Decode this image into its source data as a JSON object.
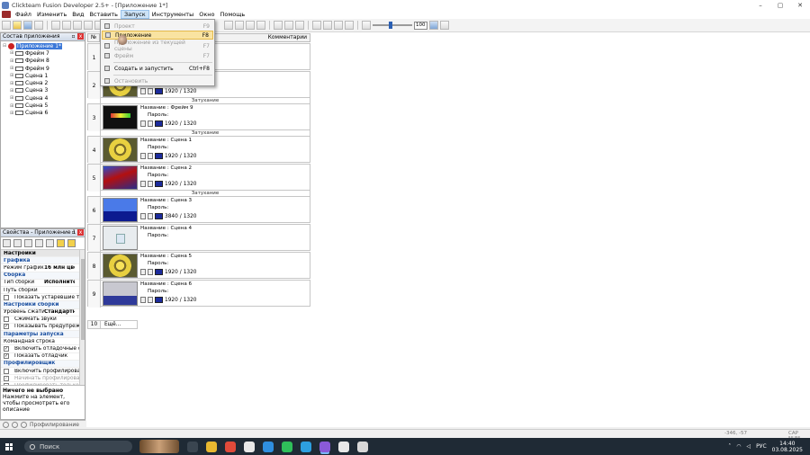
{
  "window": {
    "title": "Clickteam Fusion Developer 2.5+ - [Приложение 1*]"
  },
  "menubar": {
    "items": [
      "Файл",
      "Изменить",
      "Вид",
      "Вставить",
      "Запуск",
      "Инструменты",
      "Окно",
      "Помощь"
    ],
    "active_index": 4
  },
  "toolbar": {
    "zoom_value": "100",
    "zoom_level": 0.45
  },
  "run_menu": {
    "items": [
      {
        "label": "Проект",
        "shortcut": "F9",
        "enabled": false,
        "icon": "project-icon"
      },
      {
        "label": "Приложение",
        "shortcut": "F8",
        "enabled": true,
        "icon": "application-icon"
      },
      {
        "label": "Приложение из текущей сцены",
        "shortcut": "F7",
        "enabled": false,
        "icon": "app-from-scene-icon"
      },
      {
        "label": "Фрейм",
        "shortcut": "F7",
        "enabled": false,
        "icon": "frame-icon"
      },
      {
        "label": "Создать и запустить",
        "shortcut": "Ctrl+F8",
        "enabled": true,
        "icon": "build-run-icon"
      },
      {
        "label": "Остановить",
        "shortcut": "",
        "enabled": false,
        "icon": "stop-icon"
      }
    ]
  },
  "workspace": {
    "header": "Состав приложения",
    "root": "Приложение 1*",
    "items": [
      "Фрейм 7",
      "Фрейм 8",
      "Фрейм 9",
      "Сцена 1",
      "Сцена 2",
      "Сцена 3",
      "Сцена 4",
      "Сцена 5",
      "Сцена 6"
    ]
  },
  "properties": {
    "header": "Свойства - Приложение 1",
    "rows": [
      {
        "kind": "header",
        "key": "Настройки"
      },
      {
        "kind": "section",
        "key": "Графика"
      },
      {
        "kind": "kv",
        "key": "Режим графики",
        "value": "16 млн цвет"
      },
      {
        "kind": "section",
        "key": "Сборка"
      },
      {
        "kind": "kv",
        "key": "Тип сборки",
        "value": "Исполнительн"
      },
      {
        "kind": "kv",
        "key": "Путь сборки",
        "value": ""
      },
      {
        "kind": "check",
        "key": "Показать устаревшие типы",
        "checked": false
      },
      {
        "kind": "section",
        "key": "Настройки сборки"
      },
      {
        "kind": "kv",
        "key": "Уровень сжатия",
        "value": "Стандартный"
      },
      {
        "kind": "check",
        "key": "Сжимать звуки",
        "checked": false
      },
      {
        "kind": "check",
        "key": "Показывать предупреждение",
        "checked": true
      },
      {
        "kind": "section",
        "key": "Параметры запуска"
      },
      {
        "kind": "plain",
        "key": "Командная строка"
      },
      {
        "kind": "check",
        "key": "Включить отладочные соо",
        "checked": true
      },
      {
        "kind": "check",
        "key": "Показать отладчик",
        "checked": true
      },
      {
        "kind": "section",
        "key": "Профилировщик"
      },
      {
        "kind": "check",
        "key": "Включить профилирование",
        "checked": false
      },
      {
        "kind": "check",
        "key": "Начинать профилирован",
        "checked": true,
        "disabled": true
      },
      {
        "kind": "check",
        "key": "Профилировать только в",
        "checked": false,
        "disabled": true
      }
    ],
    "desc_title": "Ничего не выбрано",
    "desc_text": "Нажмите на элемент, чтобы просмотреть его описание"
  },
  "bottom_tabs": {
    "label": "Профилирование"
  },
  "storyboard": {
    "col_num": "№",
    "col_comments": "Комментарии",
    "name_prefix": "Название :",
    "password_label": "Пароль:",
    "transition_label": "Затухание",
    "frames": [
      {
        "num": "1",
        "name": "",
        "res_w": "",
        "res_h": "",
        "thumb": "none",
        "transition": ""
      },
      {
        "num": "2",
        "name": "",
        "res_w": "1920",
        "res_h": "1320",
        "thumb": "yellow",
        "transition": "Затухание"
      },
      {
        "num": "3",
        "name": "Фрейм 9",
        "res_w": "1920",
        "res_h": "1320",
        "thumb": "dark",
        "transition": "Затухание"
      },
      {
        "num": "4",
        "name": "Сцена 1",
        "res_w": "1920",
        "res_h": "1320",
        "thumb": "yellow",
        "transition": ""
      },
      {
        "num": "5",
        "name": "Сцена 2",
        "res_w": "1920",
        "res_h": "1320",
        "thumb": "sonic",
        "transition": "Затухание"
      },
      {
        "num": "6",
        "name": "Сцена 3",
        "res_w": "3840",
        "res_h": "1320",
        "thumb": "blue",
        "transition": ""
      },
      {
        "num": "7",
        "name": "Сцена 4",
        "res_w": "",
        "res_h": "",
        "thumb": "white",
        "transition": ""
      },
      {
        "num": "8",
        "name": "Сцена 5",
        "res_w": "1920",
        "res_h": "1320",
        "thumb": "yellow",
        "transition": ""
      },
      {
        "num": "9",
        "name": "Сцена 6",
        "res_w": "1920",
        "res_h": "1320",
        "thumb": "room",
        "transition": ""
      }
    ],
    "new_num": "10",
    "new_label": "Ещё..."
  },
  "statusbar": {
    "coords": "-346, -57",
    "caps": "CAP NUM"
  },
  "taskbar": {
    "search_placeholder": "Поиск",
    "lang": "РУС",
    "time": "14:40",
    "date": "03.08.2025",
    "apps": [
      {
        "icon": "taskview-icon",
        "color": "#3a4550"
      },
      {
        "icon": "explorer-icon",
        "color": "#e8b830"
      },
      {
        "icon": "chrome-icon",
        "color": "#e04a3a"
      },
      {
        "icon": "yandex-icon",
        "color": "#e8e8e8"
      },
      {
        "icon": "store-icon",
        "color": "#2f8fe0"
      },
      {
        "icon": "whatsapp-icon",
        "color": "#2fbf5a"
      },
      {
        "icon": "telegram-icon",
        "color": "#2d9fe0"
      },
      {
        "icon": "fusion-icon",
        "color": "#8a5ad8",
        "active": true
      },
      {
        "icon": "bolt-icon",
        "color": "#e8e8e8"
      },
      {
        "icon": "obs-icon",
        "color": "#d8d8d8"
      }
    ]
  }
}
